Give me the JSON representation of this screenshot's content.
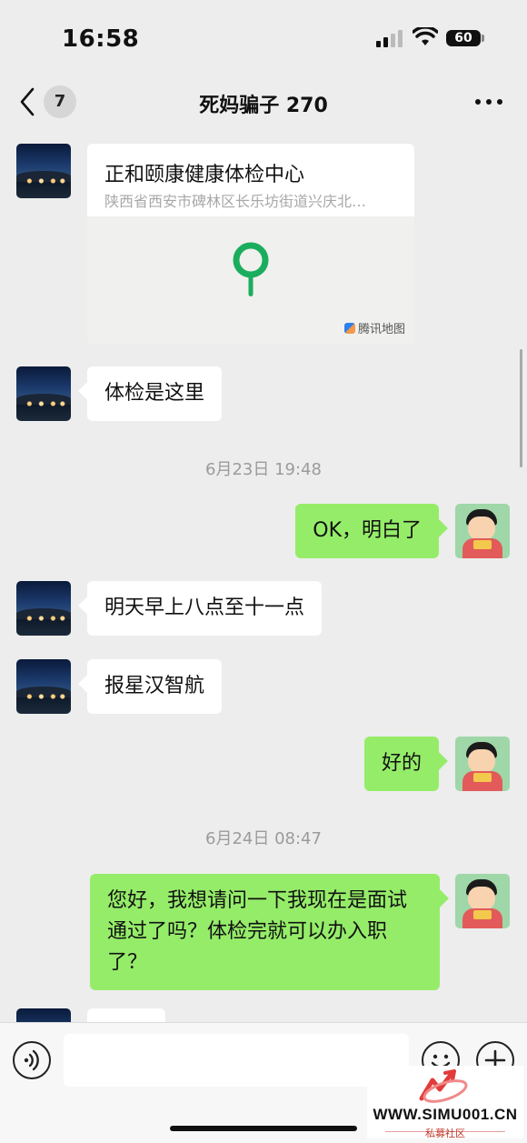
{
  "status_bar": {
    "time": "16:58",
    "battery": "60"
  },
  "header": {
    "back_badge": "7",
    "title": "死妈骗子 270",
    "more_icon": "more-dots-icon"
  },
  "messages": {
    "location": {
      "title": "正和颐康健康体检中心",
      "address": "陕西省西安市碑林区长乐坊街道兴庆北…",
      "map_credit": "腾讯地图"
    },
    "m1": "体检是这里",
    "time1": "6月23日 19:48",
    "m2": "OK，明白了",
    "m3": "明天早上八点至十一点",
    "m4": "报星汉智航",
    "m5": "好的",
    "time2": "6月24日 08:47",
    "m6": "您好，我想请问一下我现在是面试通过了吗？体检完就可以办入职了？"
  },
  "input_bar": {
    "placeholder": ""
  },
  "watermark": {
    "site": "WWW.SIMU001.CN",
    "subtitle": "私募社区"
  },
  "colors": {
    "outgoing_bubble": "#95ec69",
    "incoming_bubble": "#ffffff",
    "background": "#ededed",
    "pin_green": "#1aad5d"
  }
}
